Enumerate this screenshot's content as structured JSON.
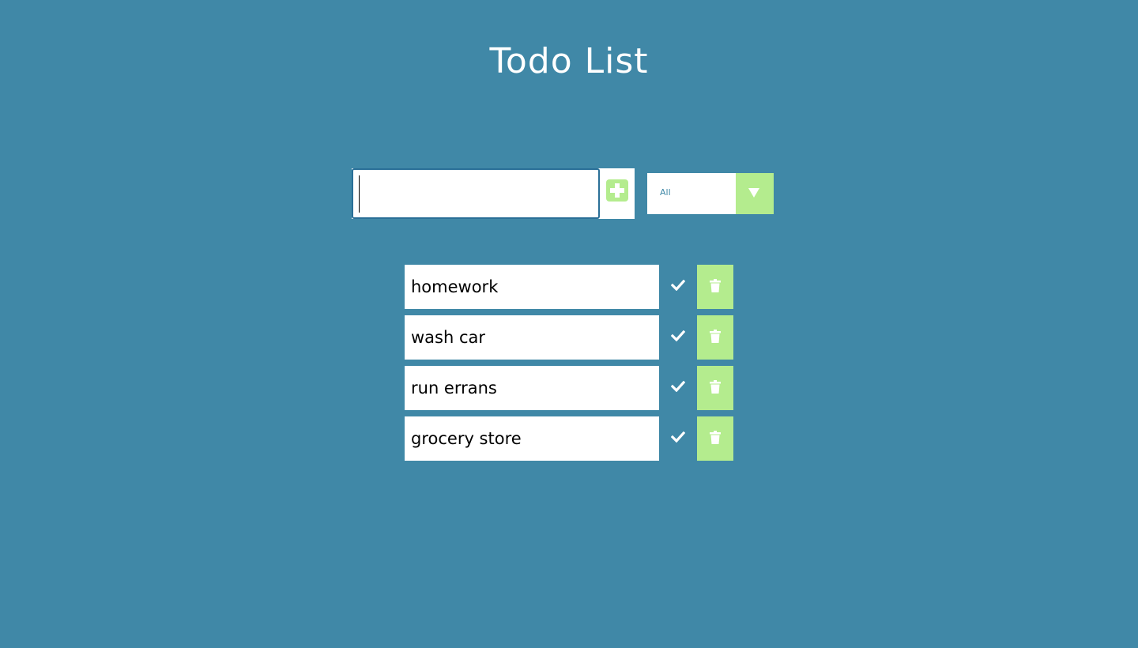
{
  "page": {
    "title": "Todo List"
  },
  "add_form": {
    "input_value": "",
    "add_icon": "plus-square-icon"
  },
  "filter": {
    "selected": "All",
    "arrow_icon": "triangle-down-icon"
  },
  "todos": [
    {
      "text": "homework",
      "check_icon": "check-icon",
      "trash_icon": "trash-icon"
    },
    {
      "text": "wash car",
      "check_icon": "check-icon",
      "trash_icon": "trash-icon"
    },
    {
      "text": "run errans",
      "check_icon": "check-icon",
      "trash_icon": "trash-icon"
    },
    {
      "text": "grocery store",
      "check_icon": "check-icon",
      "trash_icon": "trash-icon"
    }
  ],
  "colors": {
    "background": "#4088a7",
    "accent": "#b4ec8e",
    "surface": "#ffffff",
    "focus_border": "#2a6f97"
  }
}
